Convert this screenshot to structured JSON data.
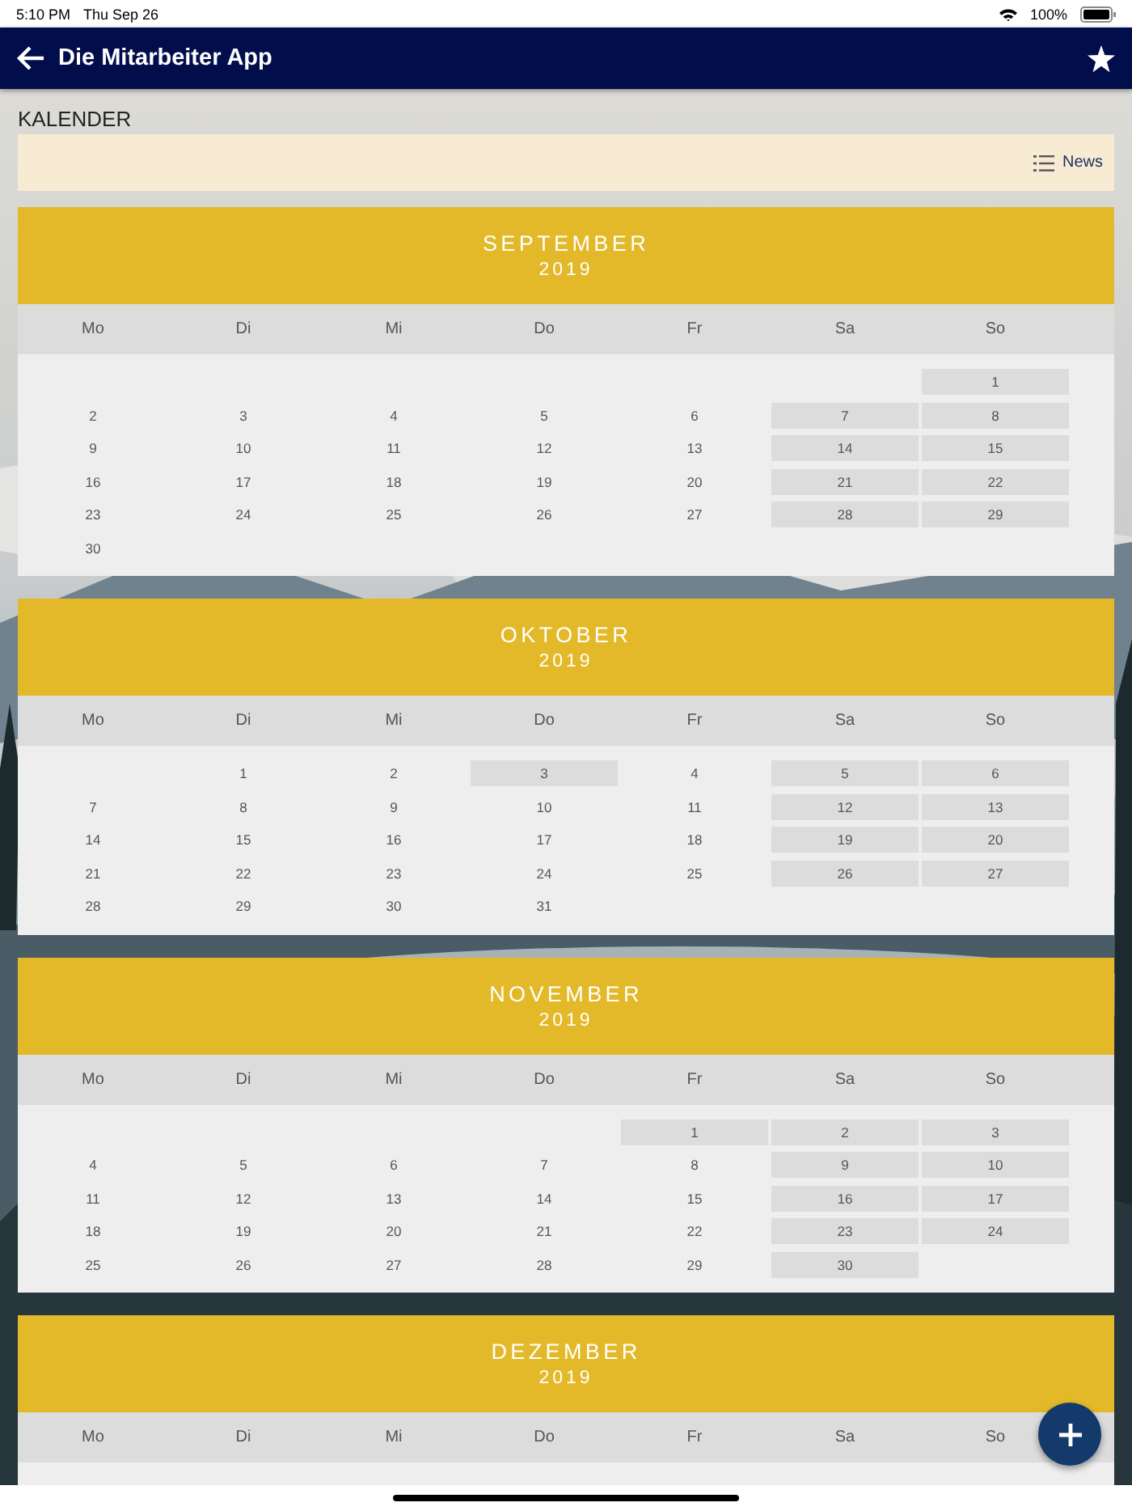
{
  "status_bar": {
    "time": "5:10 PM",
    "date": "Thu Sep 26",
    "battery": "100%"
  },
  "app_bar": {
    "title": "Die Mitarbeiter App"
  },
  "page_title": "KALENDER",
  "news_bar": {
    "label": "News"
  },
  "months": [
    {
      "name": "SEPTEMBER",
      "year": "2019",
      "weekdays": [
        "Mo",
        "Di",
        "Mi",
        "Do",
        "Fr",
        "Sa",
        "So"
      ],
      "weeks": [
        [
          {
            "kind": "blank"
          },
          {
            "kind": "blank"
          },
          {
            "kind": "blank"
          },
          {
            "kind": "blank"
          },
          {
            "kind": "blank"
          },
          {
            "kind": "blank"
          },
          {
            "kind": "day",
            "day": "1",
            "highlighted": true
          }
        ],
        [
          {
            "kind": "day",
            "day": "2",
            "highlighted": false
          },
          {
            "kind": "day",
            "day": "3",
            "highlighted": false
          },
          {
            "kind": "day",
            "day": "4",
            "highlighted": false
          },
          {
            "kind": "day",
            "day": "5",
            "highlighted": false
          },
          {
            "kind": "day",
            "day": "6",
            "highlighted": false
          },
          {
            "kind": "day",
            "day": "7",
            "highlighted": true
          },
          {
            "kind": "day",
            "day": "8",
            "highlighted": true
          }
        ],
        [
          {
            "kind": "day",
            "day": "9",
            "highlighted": false
          },
          {
            "kind": "day",
            "day": "10",
            "highlighted": false
          },
          {
            "kind": "day",
            "day": "11",
            "highlighted": false
          },
          {
            "kind": "day",
            "day": "12",
            "highlighted": false
          },
          {
            "kind": "day",
            "day": "13",
            "highlighted": false
          },
          {
            "kind": "day",
            "day": "14",
            "highlighted": true
          },
          {
            "kind": "day",
            "day": "15",
            "highlighted": true
          }
        ],
        [
          {
            "kind": "day",
            "day": "16",
            "highlighted": false
          },
          {
            "kind": "day",
            "day": "17",
            "highlighted": false
          },
          {
            "kind": "day",
            "day": "18",
            "highlighted": false
          },
          {
            "kind": "day",
            "day": "19",
            "highlighted": false
          },
          {
            "kind": "day",
            "day": "20",
            "highlighted": false
          },
          {
            "kind": "day",
            "day": "21",
            "highlighted": true
          },
          {
            "kind": "day",
            "day": "22",
            "highlighted": true
          }
        ],
        [
          {
            "kind": "day",
            "day": "23",
            "highlighted": false
          },
          {
            "kind": "day",
            "day": "24",
            "highlighted": false
          },
          {
            "kind": "day",
            "day": "25",
            "highlighted": false
          },
          {
            "kind": "day",
            "day": "26",
            "highlighted": false
          },
          {
            "kind": "day",
            "day": "27",
            "highlighted": false
          },
          {
            "kind": "day",
            "day": "28",
            "highlighted": true
          },
          {
            "kind": "day",
            "day": "29",
            "highlighted": true
          }
        ],
        [
          {
            "kind": "day",
            "day": "30",
            "highlighted": false
          }
        ]
      ]
    },
    {
      "name": "OKTOBER",
      "year": "2019",
      "weekdays": [
        "Mo",
        "Di",
        "Mi",
        "Do",
        "Fr",
        "Sa",
        "So"
      ],
      "weeks": [
        [
          {
            "kind": "blank"
          },
          {
            "kind": "day",
            "day": "1",
            "highlighted": false
          },
          {
            "kind": "day",
            "day": "2",
            "highlighted": false
          },
          {
            "kind": "day",
            "day": "3",
            "highlighted": true
          },
          {
            "kind": "day",
            "day": "4",
            "highlighted": false
          },
          {
            "kind": "day",
            "day": "5",
            "highlighted": true
          },
          {
            "kind": "day",
            "day": "6",
            "highlighted": true
          }
        ],
        [
          {
            "kind": "day",
            "day": "7",
            "highlighted": false
          },
          {
            "kind": "day",
            "day": "8",
            "highlighted": false
          },
          {
            "kind": "day",
            "day": "9",
            "highlighted": false
          },
          {
            "kind": "day",
            "day": "10",
            "highlighted": false
          },
          {
            "kind": "day",
            "day": "11",
            "highlighted": false
          },
          {
            "kind": "day",
            "day": "12",
            "highlighted": true
          },
          {
            "kind": "day",
            "day": "13",
            "highlighted": true
          }
        ],
        [
          {
            "kind": "day",
            "day": "14",
            "highlighted": false
          },
          {
            "kind": "day",
            "day": "15",
            "highlighted": false
          },
          {
            "kind": "day",
            "day": "16",
            "highlighted": false
          },
          {
            "kind": "day",
            "day": "17",
            "highlighted": false
          },
          {
            "kind": "day",
            "day": "18",
            "highlighted": false
          },
          {
            "kind": "day",
            "day": "19",
            "highlighted": true
          },
          {
            "kind": "day",
            "day": "20",
            "highlighted": true
          }
        ],
        [
          {
            "kind": "day",
            "day": "21",
            "highlighted": false
          },
          {
            "kind": "day",
            "day": "22",
            "highlighted": false
          },
          {
            "kind": "day",
            "day": "23",
            "highlighted": false
          },
          {
            "kind": "day",
            "day": "24",
            "highlighted": false
          },
          {
            "kind": "day",
            "day": "25",
            "highlighted": false
          },
          {
            "kind": "day",
            "day": "26",
            "highlighted": true
          },
          {
            "kind": "day",
            "day": "27",
            "highlighted": true
          }
        ],
        [
          {
            "kind": "day",
            "day": "28",
            "highlighted": false
          },
          {
            "kind": "day",
            "day": "29",
            "highlighted": false
          },
          {
            "kind": "day",
            "day": "30",
            "highlighted": false
          },
          {
            "kind": "day",
            "day": "31",
            "highlighted": false
          }
        ]
      ]
    },
    {
      "name": "NOVEMBER",
      "year": "2019",
      "weekdays": [
        "Mo",
        "Di",
        "Mi",
        "Do",
        "Fr",
        "Sa",
        "So"
      ],
      "weeks": [
        [
          {
            "kind": "blank"
          },
          {
            "kind": "blank"
          },
          {
            "kind": "blank"
          },
          {
            "kind": "blank"
          },
          {
            "kind": "day",
            "day": "1",
            "highlighted": true
          },
          {
            "kind": "day",
            "day": "2",
            "highlighted": true
          },
          {
            "kind": "day",
            "day": "3",
            "highlighted": true
          }
        ],
        [
          {
            "kind": "day",
            "day": "4",
            "highlighted": false
          },
          {
            "kind": "day",
            "day": "5",
            "highlighted": false
          },
          {
            "kind": "day",
            "day": "6",
            "highlighted": false
          },
          {
            "kind": "day",
            "day": "7",
            "highlighted": false
          },
          {
            "kind": "day",
            "day": "8",
            "highlighted": false
          },
          {
            "kind": "day",
            "day": "9",
            "highlighted": true
          },
          {
            "kind": "day",
            "day": "10",
            "highlighted": true
          }
        ],
        [
          {
            "kind": "day",
            "day": "11",
            "highlighted": false
          },
          {
            "kind": "day",
            "day": "12",
            "highlighted": false
          },
          {
            "kind": "day",
            "day": "13",
            "highlighted": false
          },
          {
            "kind": "day",
            "day": "14",
            "highlighted": false
          },
          {
            "kind": "day",
            "day": "15",
            "highlighted": false
          },
          {
            "kind": "day",
            "day": "16",
            "highlighted": true
          },
          {
            "kind": "day",
            "day": "17",
            "highlighted": true
          }
        ],
        [
          {
            "kind": "day",
            "day": "18",
            "highlighted": false
          },
          {
            "kind": "day",
            "day": "19",
            "highlighted": false
          },
          {
            "kind": "day",
            "day": "20",
            "highlighted": false
          },
          {
            "kind": "day",
            "day": "21",
            "highlighted": false
          },
          {
            "kind": "day",
            "day": "22",
            "highlighted": false
          },
          {
            "kind": "day",
            "day": "23",
            "highlighted": true
          },
          {
            "kind": "day",
            "day": "24",
            "highlighted": true
          }
        ],
        [
          {
            "kind": "day",
            "day": "25",
            "highlighted": false
          },
          {
            "kind": "day",
            "day": "26",
            "highlighted": false
          },
          {
            "kind": "day",
            "day": "27",
            "highlighted": false
          },
          {
            "kind": "day",
            "day": "28",
            "highlighted": false
          },
          {
            "kind": "day",
            "day": "29",
            "highlighted": false
          },
          {
            "kind": "day",
            "day": "30",
            "highlighted": true
          }
        ]
      ]
    },
    {
      "name": "DEZEMBER",
      "year": "2019",
      "weekdays": [
        "Mo",
        "Di",
        "Mi",
        "Do",
        "Fr",
        "Sa",
        "So"
      ]
    }
  ]
}
